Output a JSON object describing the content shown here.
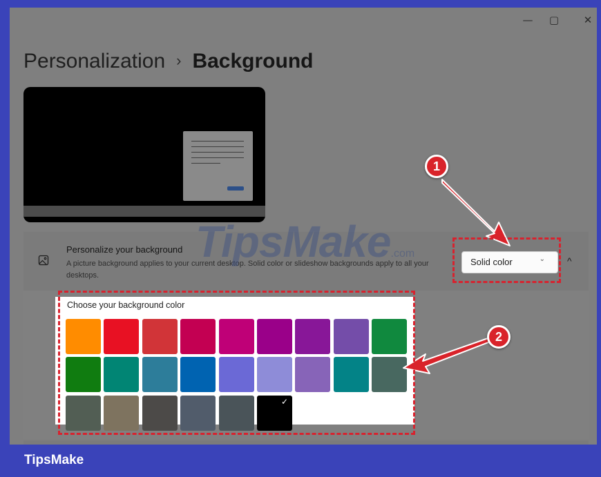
{
  "window": {
    "caption_minimize_icon": "minimize-icon",
    "caption_maximize_icon": "maximize-icon",
    "caption_close_icon": "close-icon"
  },
  "breadcrumb": {
    "parent": "Personalization",
    "separator": "›",
    "current": "Background"
  },
  "card": {
    "icon": "image-icon",
    "title": "Personalize your background",
    "description": "A picture background applies to your current desktop. Solid color or slideshow backgrounds apply to all your desktops.",
    "dropdown_value": "Solid color",
    "collapse_glyph": "^"
  },
  "picker": {
    "label": "Choose your background color",
    "selected": "#000000",
    "swatches": [
      "#ff8c00",
      "#e81123",
      "#d13438",
      "#c30052",
      "#bf0077",
      "#9a0089",
      "#881798",
      "#744da9",
      "#10893e",
      "#107c10",
      "#018574",
      "#2d7d9a",
      "#0063b1",
      "#6b69d6",
      "#8e8cd8",
      "#8764b8",
      "#038387",
      "#486860",
      "#525e54",
      "#7e735f",
      "#4c4a48",
      "#515c6b",
      "#4a5459",
      "#000000"
    ]
  },
  "annotations": {
    "badge1": "1",
    "badge2": "2",
    "color": "#d8222e"
  },
  "watermark": {
    "main": "TipsMake",
    "suffix": ".com"
  },
  "footer": {
    "brand": "TipsMake"
  }
}
